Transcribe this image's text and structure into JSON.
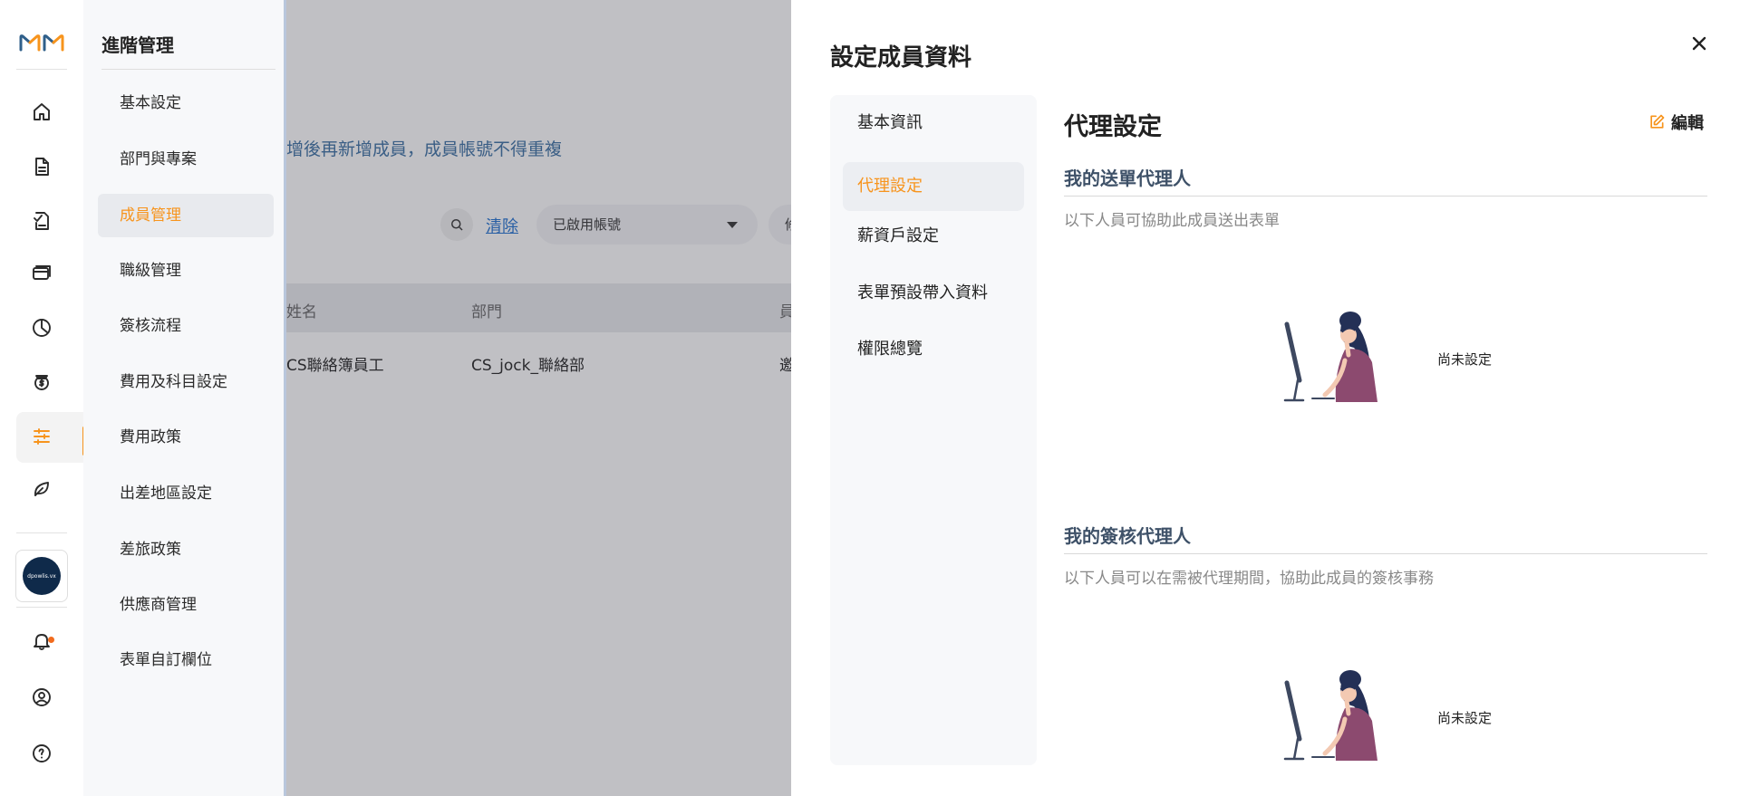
{
  "rail": {
    "icons": [
      "home-icon",
      "document-icon",
      "approval-icon",
      "card-icon",
      "pie-chart-icon",
      "money-icon",
      "settings-sliders-icon",
      "leaf-icon",
      "bell-icon",
      "user-circle-icon",
      "help-icon"
    ],
    "avatar_text": "dpowlis.vx"
  },
  "menu": {
    "title": "進階管理",
    "items": [
      {
        "label": "基本設定"
      },
      {
        "label": "部門與專案"
      },
      {
        "label": "成員管理"
      },
      {
        "label": "職級管理"
      },
      {
        "label": "簽核流程"
      },
      {
        "label": "費用及科目設定"
      },
      {
        "label": "費用政策"
      },
      {
        "label": "出差地區設定"
      },
      {
        "label": "差旅政策"
      },
      {
        "label": "供應商管理"
      },
      {
        "label": "表單自訂欄位"
      }
    ],
    "active_index": 2
  },
  "main": {
    "notice": "增後再新增成員，成員帳號不得重複",
    "clear_link": "清除",
    "status_select": "已啟用帳號",
    "next_select": "修",
    "table": {
      "headers": [
        "姓名",
        "部門",
        "員"
      ],
      "rows": [
        [
          "CS聯絡簿員工",
          "CS_jock_聯絡部",
          "邀"
        ]
      ]
    }
  },
  "drawer": {
    "title": "設定成員資料",
    "nav": [
      {
        "label": "基本資訊"
      },
      {
        "label": "代理設定"
      },
      {
        "label": "薪資戶設定"
      },
      {
        "label": "表單預設帶入資料"
      },
      {
        "label": "權限總覽"
      }
    ],
    "active_nav": 1,
    "panel": {
      "title": "代理設定",
      "edit_label": "編輯",
      "sections": [
        {
          "title": "我的送單代理人",
          "desc": "以下人員可協助此成員送出表單",
          "empty_label": "尚未設定"
        },
        {
          "title": "我的簽核代理人",
          "desc": "以下人員可以在需被代理期間，協助此成員的簽核事務",
          "empty_label": "尚未設定"
        }
      ]
    }
  },
  "colors": {
    "accent": "#f7941d",
    "link": "#1e6fd0",
    "section_title": "#3e5168"
  }
}
